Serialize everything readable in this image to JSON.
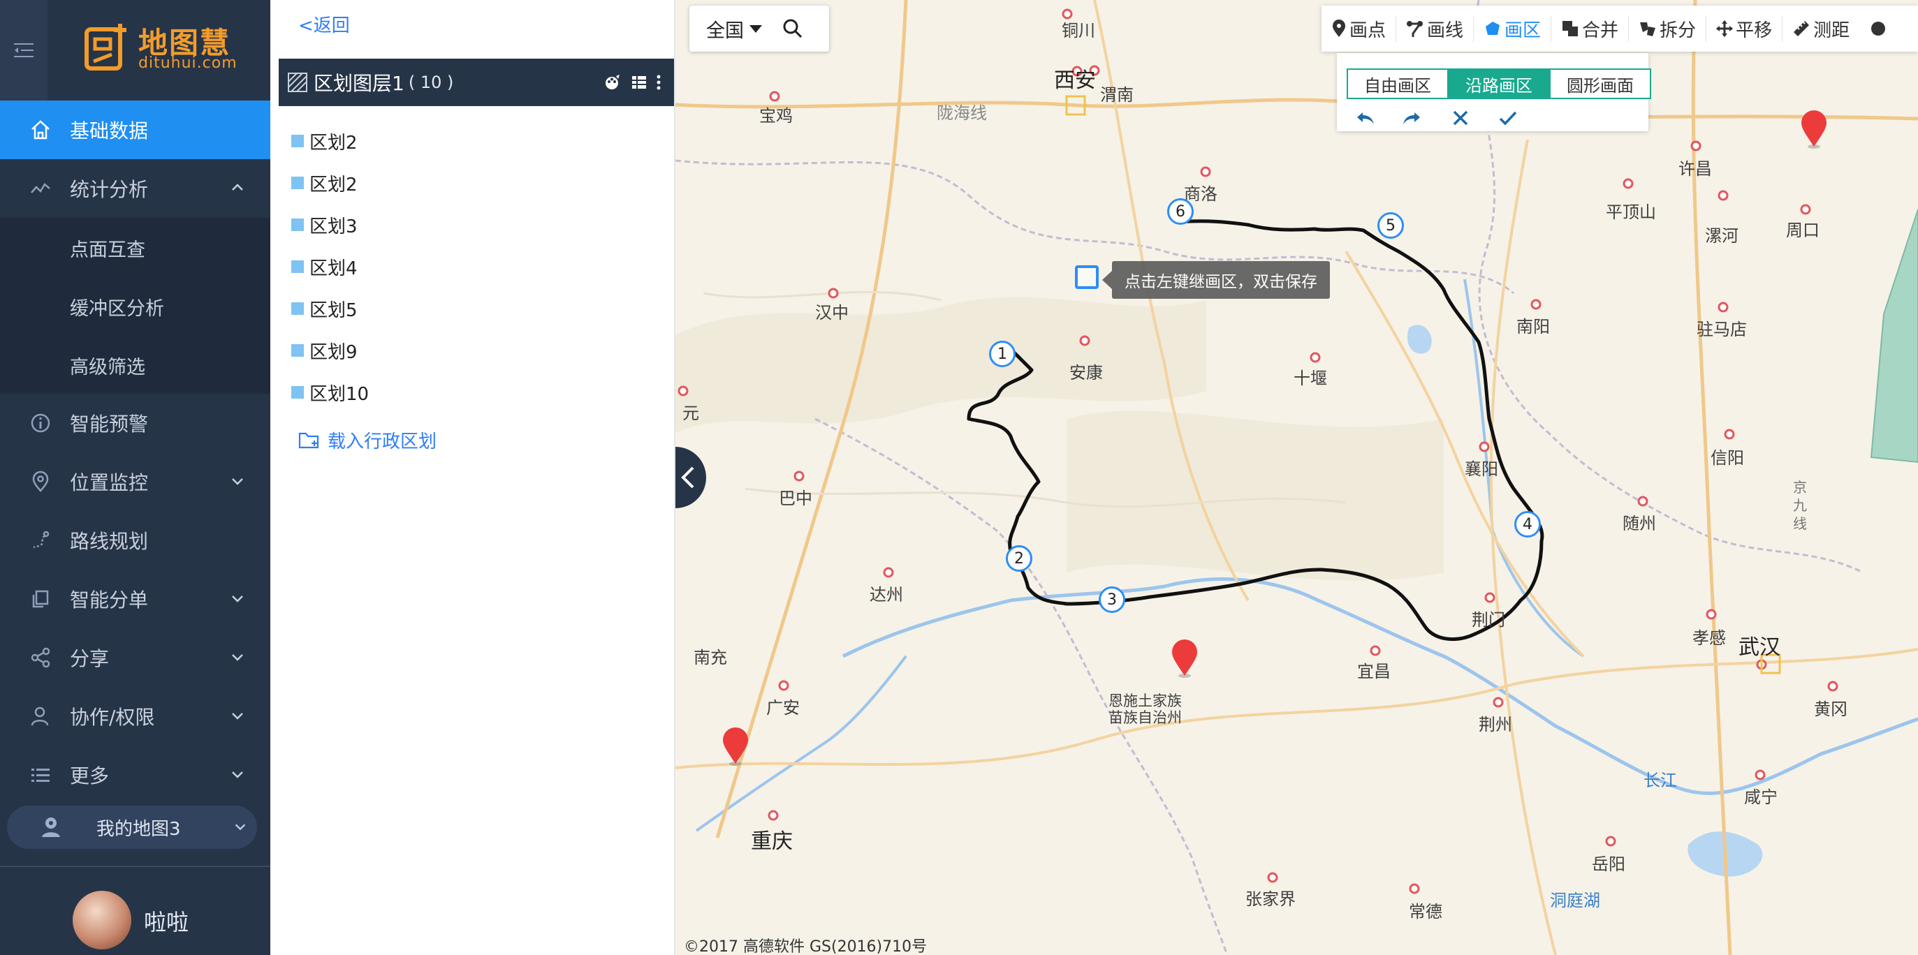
{
  "app": {
    "logo_text": "地图慧",
    "logo_sub": "dituhui.com"
  },
  "sidebar": {
    "items": [
      {
        "label": "基础数据",
        "icon": "home-icon",
        "active": true
      },
      {
        "label": "统计分析",
        "icon": "chart-line-icon",
        "expanded": true
      },
      {
        "label": "智能预警",
        "icon": "info-icon"
      },
      {
        "label": "位置监控",
        "icon": "location-pin-icon"
      },
      {
        "label": "路线规划",
        "icon": "route-icon"
      },
      {
        "label": "智能分单",
        "icon": "copy-icon"
      },
      {
        "label": "分享",
        "icon": "share-icon"
      },
      {
        "label": "协作/权限",
        "icon": "user-icon"
      },
      {
        "label": "更多",
        "icon": "list-icon"
      }
    ],
    "sub_items": [
      "点面互查",
      "缓冲区分析",
      "高级筛选"
    ],
    "my_map": "我的地图3",
    "user_name": "啦啦"
  },
  "panel": {
    "back_label": "<返回",
    "layer_title": "区划图层1",
    "layer_count": "( 10 )",
    "regions": [
      "区划2",
      "区划2",
      "区划3",
      "区划4",
      "区划5",
      "区划9",
      "区划10"
    ],
    "load_admin_label": "载入行政区划",
    "region_color": "#7ec3f2"
  },
  "map": {
    "region_select": "全国",
    "toolbar": [
      "画点",
      "画线",
      "画区",
      "合并",
      "拆分",
      "平移",
      "测距"
    ],
    "active_tool": "画区",
    "draw_modes": [
      "自由画区",
      "沿路画区",
      "圆形画面"
    ],
    "active_mode": "沿路画区",
    "tooltip": "点击左键继画区，双击保存",
    "vertices": [
      "1",
      "2",
      "3",
      "4",
      "5",
      "6"
    ],
    "copyright": "©2017 高德软件 GS(2016)710号",
    "accent_color": "#19a98f",
    "cities": {
      "tongchuan": "铜川",
      "xian": "西安",
      "weinan": "渭南",
      "baoji": "宝鸡",
      "longhai": "陇海线",
      "shangluo": "商洛",
      "xuchang": "许昌",
      "pingdingshan": "平顶山",
      "luohe": "漯河",
      "zhoukou": "周口",
      "hanzhong": "汉中",
      "ankang": "安康",
      "shiyan": "十堰",
      "nanyang": "南阳",
      "zhumadian": "驻马店",
      "xinyang": "信阳",
      "xiangyang": "襄阳",
      "bazhong": "巴中",
      "dazhou": "达州",
      "suizhou": "随州",
      "jingmen": "荆门",
      "xiaogan": "孝感",
      "wuhan": "武汉",
      "nanchong": "南充",
      "guangan": "广安",
      "yichang": "宜昌",
      "enshi1": "恩施土家族",
      "enshi2": "苗族自治州",
      "jingzhou": "荆州",
      "huanggang": "黄冈",
      "chongqing": "重庆",
      "changjiang": "长江",
      "xianning": "咸宁",
      "yueyang": "岳阳",
      "zhangjiajie": "张家界",
      "changde": "常德",
      "dongtinghu": "洞庭湖",
      "guangyuan": "元",
      "jingjiu1": "京",
      "jingjiu2": "九",
      "jingjiu3": "线"
    }
  }
}
